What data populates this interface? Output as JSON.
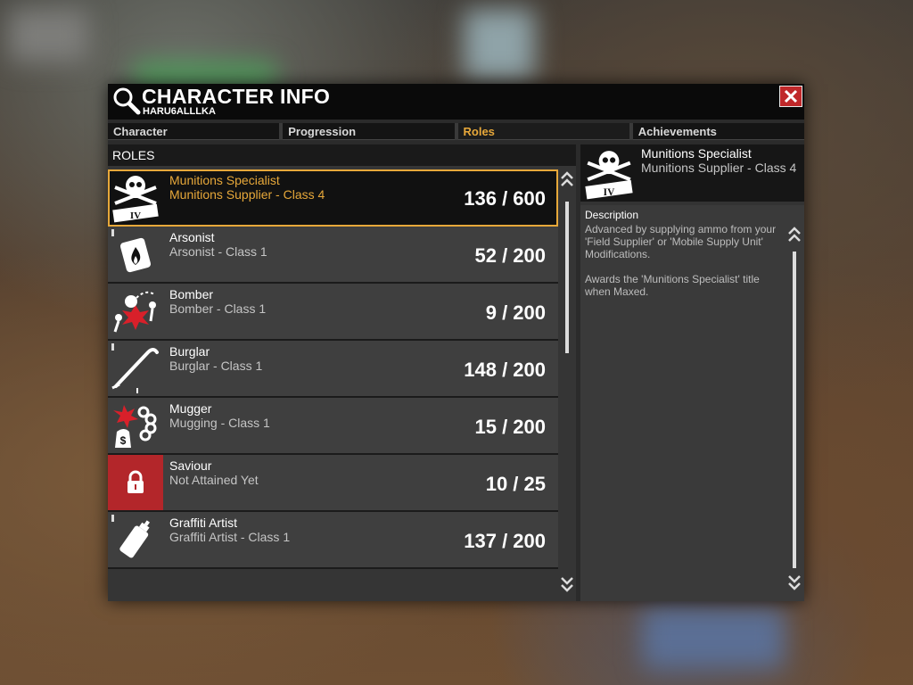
{
  "window": {
    "title": "CHARACTER INFO",
    "subtitle": "HARU6ALLLKA"
  },
  "tabs": [
    {
      "label": "Character",
      "active": false
    },
    {
      "label": "Progression",
      "active": false
    },
    {
      "label": "Roles",
      "active": true
    },
    {
      "label": "Achievements",
      "active": false
    }
  ],
  "roles_header": "ROLES",
  "roles": [
    {
      "name": "Munitions Specialist",
      "class": "Munitions Supplier - Class 4",
      "progress": "136 / 600",
      "icon": "skull-crossed-guns-icon",
      "selected": true
    },
    {
      "name": "Arsonist",
      "class": "Arsonist - Class 1",
      "progress": "52 / 200",
      "icon": "fire-card-icon"
    },
    {
      "name": "Bomber",
      "class": "Bomber - Class 1",
      "progress": "9 / 200",
      "icon": "bomb-explosion-icon"
    },
    {
      "name": "Burglar",
      "class": "Burglar - Class 1",
      "progress": "148 / 200",
      "icon": "crowbar-icon"
    },
    {
      "name": "Mugger",
      "class": "Mugging - Class 1",
      "progress": "15 / 200",
      "icon": "brass-knuckles-icon"
    },
    {
      "name": "Saviour",
      "class": "Not Attained Yet",
      "progress": "10 / 25",
      "icon": "lock-icon",
      "locked": true
    },
    {
      "name": "Graffiti Artist",
      "class": "Graffiti Artist - Class 1",
      "progress": "137 / 200",
      "icon": "spray-can-icon"
    }
  ],
  "detail": {
    "name": "Munitions Specialist",
    "class": "Munitions Supplier - Class 4",
    "desc_title": "Description",
    "desc_text": "Advanced by supplying ammo from your 'Field Supplier' or 'Mobile Supply Unit' Modifications.\n\nAwards the 'Munitions Specialist' title when Maxed."
  },
  "colors": {
    "accent": "#e7a83a",
    "close": "#c0282a",
    "locked": "#b3262a"
  }
}
